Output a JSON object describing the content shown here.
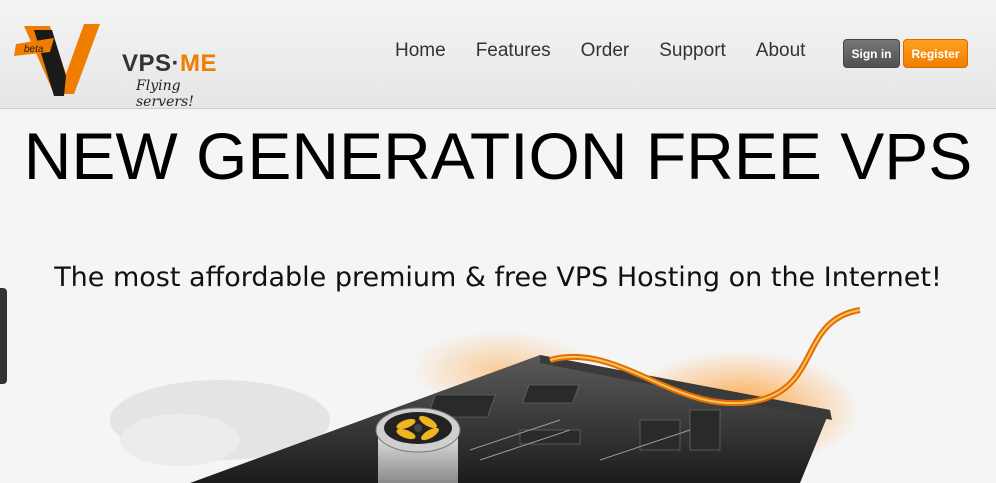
{
  "brand": {
    "logo_badge": "beta",
    "name_prefix": "VPS·",
    "name_suffix": "ME",
    "tagline": "Flying servers!"
  },
  "nav": {
    "items": [
      "Home",
      "Features",
      "Order",
      "Support",
      "About"
    ]
  },
  "auth": {
    "signin_label": "Sign in",
    "register_label": "Register"
  },
  "hero": {
    "title": "NEW GENERATION FREE VPS",
    "subtitle": "The most affordable premium & free VPS Hosting on the Internet!"
  },
  "colors": {
    "accent": "#f07d00",
    "dark_button": "#555555",
    "header_bg": "#ececec"
  }
}
